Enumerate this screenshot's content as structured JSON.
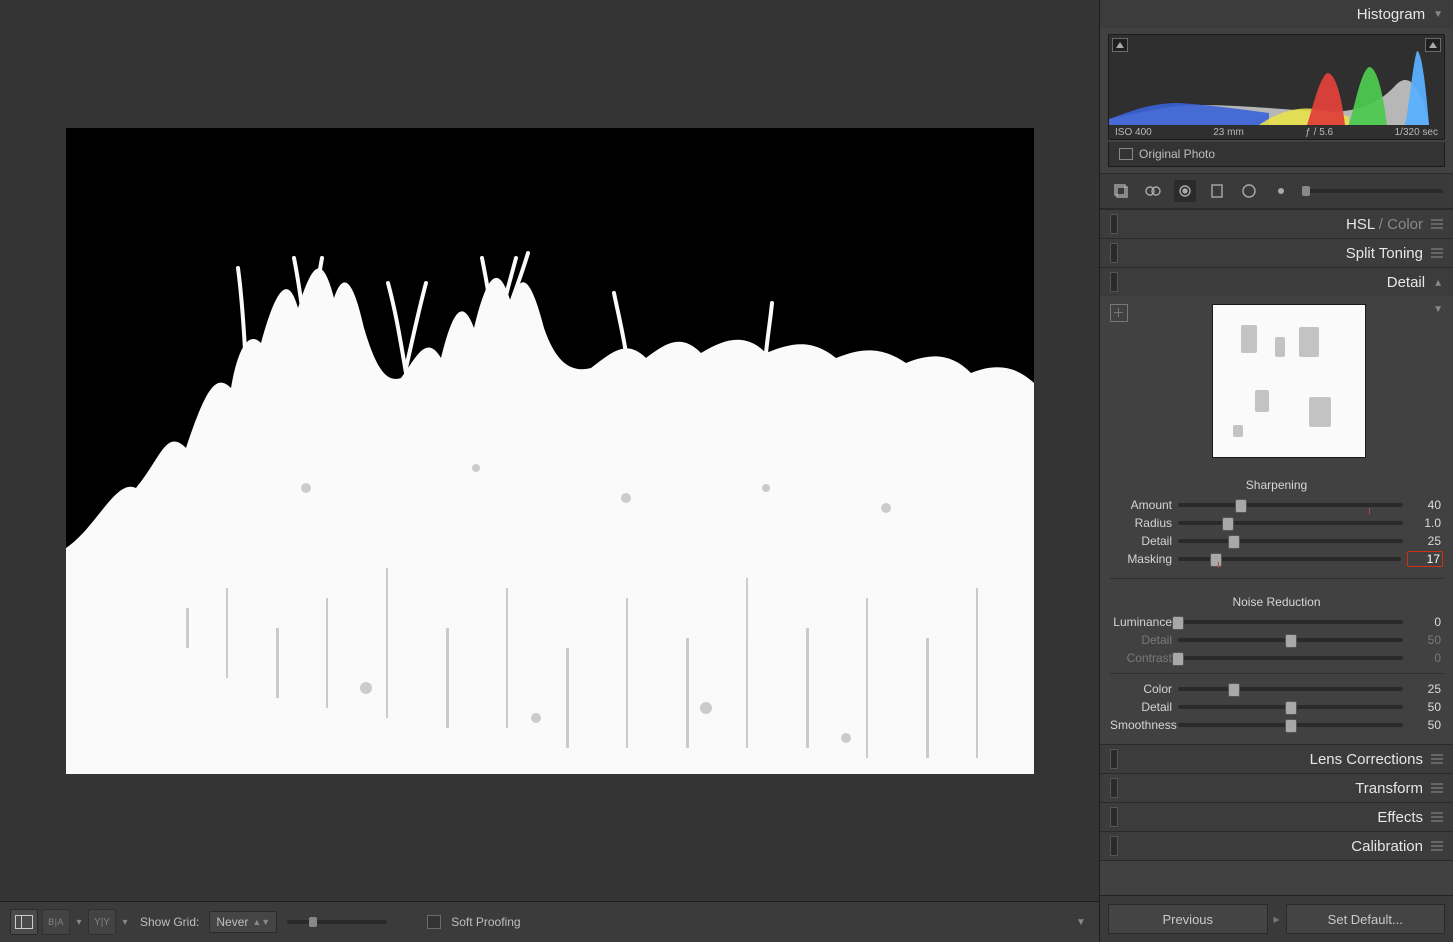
{
  "histogram": {
    "title": "Histogram",
    "meta": {
      "iso": "ISO 400",
      "focal": "23 mm",
      "aperture": "ƒ / 5.6",
      "shutter": "1/320 sec"
    },
    "original_photo_label": "Original Photo"
  },
  "tools": {
    "items": [
      "crop-tool",
      "spot-removal-tool",
      "redeye-tool",
      "graduated-filter-tool",
      "radial-filter-tool",
      "brush-tool"
    ],
    "active_index": 2
  },
  "panels": {
    "hsl_color": {
      "title_a": "HSL",
      "title_sep": " / ",
      "title_b": "Color"
    },
    "split_toning": {
      "title": "Split Toning"
    },
    "detail": {
      "title": "Detail",
      "sharpening": {
        "heading": "Sharpening",
        "rows": [
          {
            "label": "Amount",
            "value": "40",
            "pct": 28,
            "dim": false,
            "hi": false,
            "red_tick": 85
          },
          {
            "label": "Radius",
            "value": "1.0",
            "pct": 22,
            "dim": false,
            "hi": false
          },
          {
            "label": "Detail",
            "value": "25",
            "pct": 25,
            "dim": false,
            "hi": false
          },
          {
            "label": "Masking",
            "value": "17",
            "pct": 17,
            "dim": false,
            "hi": true,
            "red_tick": 18
          }
        ]
      },
      "noise_reduction": {
        "heading": "Noise Reduction",
        "rows": [
          {
            "label": "Luminance",
            "value": "0",
            "pct": 0,
            "dim": false,
            "hi": false
          },
          {
            "label": "Detail",
            "value": "50",
            "pct": 50,
            "dim": true,
            "hi": false
          },
          {
            "label": "Contrast",
            "value": "0",
            "pct": 0,
            "dim": true,
            "hi": false
          }
        ],
        "rows2": [
          {
            "label": "Color",
            "value": "25",
            "pct": 25,
            "dim": false,
            "hi": false
          },
          {
            "label": "Detail",
            "value": "50",
            "pct": 50,
            "dim": false,
            "hi": false
          },
          {
            "label": "Smoothness",
            "value": "50",
            "pct": 50,
            "dim": false,
            "hi": false
          }
        ]
      }
    },
    "lens_corrections": {
      "title": "Lens Corrections"
    },
    "transform": {
      "title": "Transform"
    },
    "effects": {
      "title": "Effects"
    },
    "calibration": {
      "title": "Calibration"
    }
  },
  "side_buttons": {
    "previous": "Previous",
    "set_default": "Set Default..."
  },
  "toolbar": {
    "show_grid_label": "Show Grid:",
    "show_grid_value": "Never",
    "soft_proofing_label": "Soft Proofing"
  }
}
